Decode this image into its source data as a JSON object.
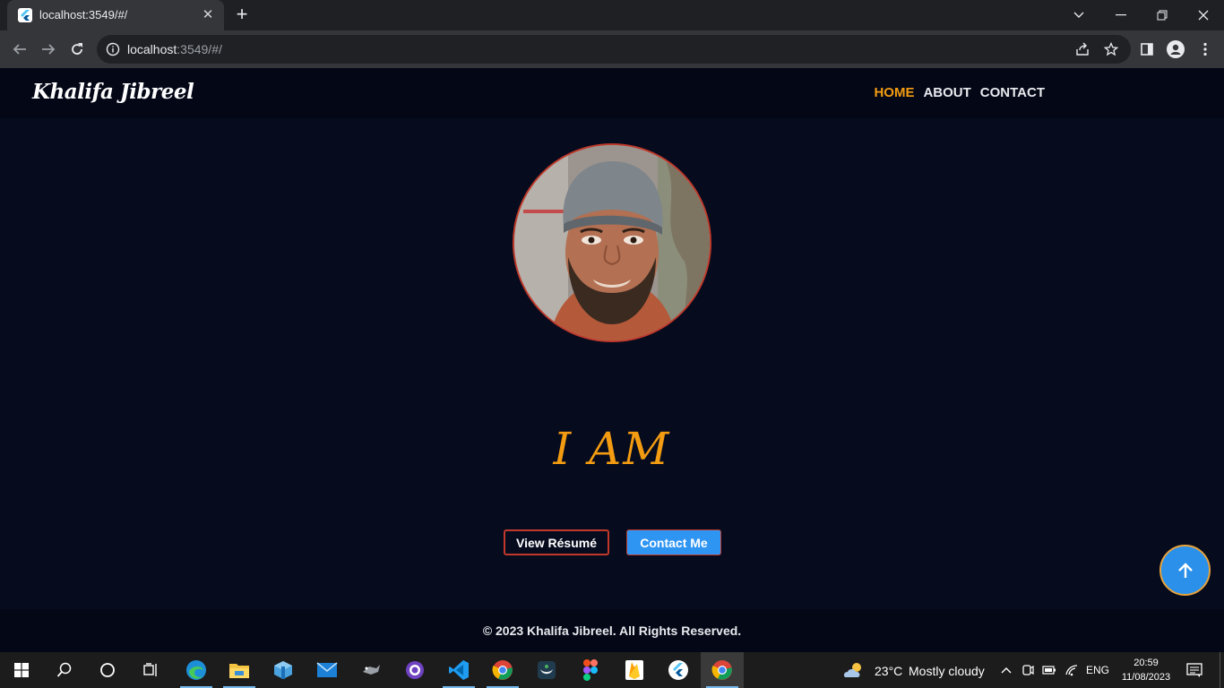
{
  "browser": {
    "tab_title": "localhost:3549/#/",
    "tab_close": "✕",
    "new_tab": "+",
    "url_host": "localhost",
    "url_rest": ":3549/#/"
  },
  "site": {
    "brand": "Khalifa Jibreel",
    "nav": [
      {
        "label": "HOME",
        "active": true
      },
      {
        "label": "ABOUT",
        "active": false
      },
      {
        "label": "CONTACT",
        "active": false
      }
    ],
    "hero_heading": "I AM",
    "buttons": {
      "resume": "View Résumé",
      "contact": "Contact Me"
    },
    "footer": "© 2023 Khalifa Jibreel. All Rights Reserved.",
    "accent_color": "#f39c12",
    "primary_color": "#2f95f3"
  },
  "taskbar": {
    "weather_temp": "23°C",
    "weather_text": "Mostly cloudy",
    "language": "ENG",
    "time": "20:59",
    "date": "11/08/2023",
    "apps": [
      "windows-start",
      "search",
      "cortana",
      "task-view",
      "edge",
      "file-explorer",
      "azure-storage",
      "mail",
      "unknown-app",
      "github-desktop",
      "vscode",
      "chrome",
      "mongodb-compass",
      "figma",
      "firebase",
      "flutter",
      "chrome-active"
    ]
  }
}
